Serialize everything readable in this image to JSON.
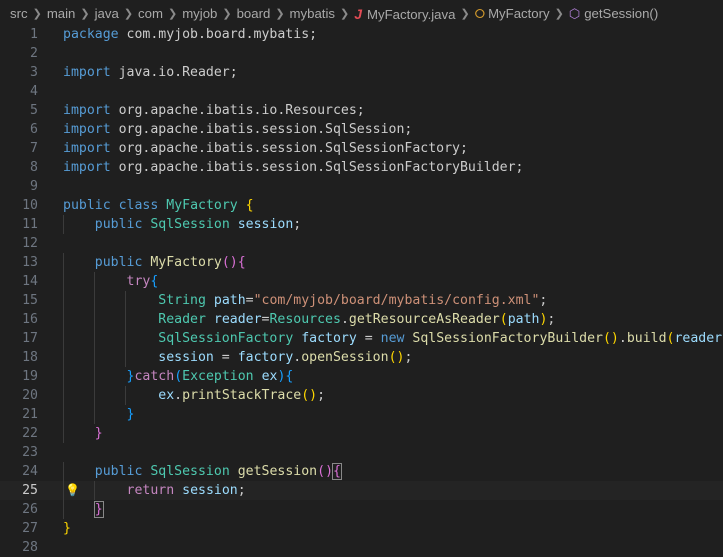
{
  "breadcrumb": {
    "items": [
      "src",
      "main",
      "java",
      "com",
      "myjob",
      "board",
      "mybatis"
    ],
    "file": "MyFactory.java",
    "class": "MyFactory",
    "method": "getSession()"
  },
  "editor": {
    "current_line": 25,
    "lines": [
      {
        "n": "1",
        "t": [
          [
            "kw",
            "package"
          ],
          [
            "pl",
            " com.myjob.board.mybatis;"
          ]
        ]
      },
      {
        "n": "2",
        "t": []
      },
      {
        "n": "3",
        "t": [
          [
            "kw",
            "import"
          ],
          [
            "pl",
            " java.io.Reader;"
          ]
        ]
      },
      {
        "n": "4",
        "t": []
      },
      {
        "n": "5",
        "t": [
          [
            "kw",
            "import"
          ],
          [
            "pl",
            " org.apache.ibatis.io.Resources;"
          ]
        ]
      },
      {
        "n": "6",
        "t": [
          [
            "kw",
            "import"
          ],
          [
            "pl",
            " org.apache.ibatis.session.SqlSession;"
          ]
        ]
      },
      {
        "n": "7",
        "t": [
          [
            "kw",
            "import"
          ],
          [
            "pl",
            " org.apache.ibatis.session.SqlSessionFactory;"
          ]
        ]
      },
      {
        "n": "8",
        "t": [
          [
            "kw",
            "import"
          ],
          [
            "pl",
            " org.apache.ibatis.session.SqlSessionFactoryBuilder;"
          ]
        ]
      },
      {
        "n": "9",
        "t": []
      },
      {
        "n": "10",
        "t": [
          [
            "kw",
            "public"
          ],
          [
            "pl",
            " "
          ],
          [
            "kw",
            "class"
          ],
          [
            "pl",
            " "
          ],
          [
            "ty",
            "MyFactory"
          ],
          [
            "pl",
            " "
          ],
          [
            "b1",
            "{"
          ]
        ]
      },
      {
        "n": "11",
        "t": [
          [
            "pl",
            "    "
          ],
          [
            "kw",
            "public"
          ],
          [
            "pl",
            " "
          ],
          [
            "ty",
            "SqlSession"
          ],
          [
            "pl",
            " "
          ],
          [
            "va",
            "session"
          ],
          [
            "pl",
            ";"
          ]
        ]
      },
      {
        "n": "12",
        "t": []
      },
      {
        "n": "13",
        "t": [
          [
            "pl",
            "    "
          ],
          [
            "kw",
            "public"
          ],
          [
            "pl",
            " "
          ],
          [
            "fn",
            "MyFactory"
          ],
          [
            "b2",
            "()"
          ],
          [
            "b2",
            "{"
          ]
        ]
      },
      {
        "n": "14",
        "t": [
          [
            "pl",
            "        "
          ],
          [
            "kc",
            "try"
          ],
          [
            "b3",
            "{"
          ]
        ]
      },
      {
        "n": "15",
        "t": [
          [
            "pl",
            "            "
          ],
          [
            "ty",
            "String"
          ],
          [
            "pl",
            " "
          ],
          [
            "va",
            "path"
          ],
          [
            "pl",
            "="
          ],
          [
            "st",
            "\"com/myjob/board/mybatis/config.xml\""
          ],
          [
            "pl",
            ";"
          ]
        ]
      },
      {
        "n": "16",
        "t": [
          [
            "pl",
            "            "
          ],
          [
            "ty",
            "Reader"
          ],
          [
            "pl",
            " "
          ],
          [
            "va",
            "reader"
          ],
          [
            "pl",
            "="
          ],
          [
            "ty",
            "Resources"
          ],
          [
            "pl",
            "."
          ],
          [
            "fn",
            "getResourceAsReader"
          ],
          [
            "b1",
            "("
          ],
          [
            "va",
            "path"
          ],
          [
            "b1",
            ")"
          ],
          [
            "pl",
            ";"
          ]
        ]
      },
      {
        "n": "17",
        "t": [
          [
            "pl",
            "            "
          ],
          [
            "ty",
            "SqlSessionFactory"
          ],
          [
            "pl",
            " "
          ],
          [
            "va",
            "factory"
          ],
          [
            "pl",
            " = "
          ],
          [
            "kw",
            "new"
          ],
          [
            "pl",
            " "
          ],
          [
            "fn",
            "SqlSessionFactoryBuilder"
          ],
          [
            "b1",
            "()"
          ],
          [
            "pl",
            "."
          ],
          [
            "fn",
            "build"
          ],
          [
            "b1",
            "("
          ],
          [
            "va",
            "reader"
          ],
          [
            "b1",
            ")"
          ],
          [
            "pl",
            ";"
          ]
        ]
      },
      {
        "n": "18",
        "t": [
          [
            "pl",
            "            "
          ],
          [
            "va",
            "session"
          ],
          [
            "pl",
            " = "
          ],
          [
            "va",
            "factory"
          ],
          [
            "pl",
            "."
          ],
          [
            "fn",
            "openSession"
          ],
          [
            "b1",
            "()"
          ],
          [
            "pl",
            ";"
          ]
        ]
      },
      {
        "n": "19",
        "t": [
          [
            "pl",
            "        "
          ],
          [
            "b3",
            "}"
          ],
          [
            "kc",
            "catch"
          ],
          [
            "b3",
            "("
          ],
          [
            "ty",
            "Exception"
          ],
          [
            "pl",
            " "
          ],
          [
            "va",
            "ex"
          ],
          [
            "b3",
            ")"
          ],
          [
            "b3",
            "{"
          ]
        ]
      },
      {
        "n": "20",
        "t": [
          [
            "pl",
            "            "
          ],
          [
            "va",
            "ex"
          ],
          [
            "pl",
            "."
          ],
          [
            "fn",
            "printStackTrace"
          ],
          [
            "b1",
            "()"
          ],
          [
            "pl",
            ";"
          ]
        ]
      },
      {
        "n": "21",
        "t": [
          [
            "pl",
            "        "
          ],
          [
            "b3",
            "}"
          ]
        ]
      },
      {
        "n": "22",
        "t": [
          [
            "pl",
            "    "
          ],
          [
            "b2",
            "}"
          ]
        ]
      },
      {
        "n": "23",
        "t": []
      },
      {
        "n": "24",
        "t": [
          [
            "pl",
            "    "
          ],
          [
            "kw",
            "public"
          ],
          [
            "pl",
            " "
          ],
          [
            "ty",
            "SqlSession"
          ],
          [
            "pl",
            " "
          ],
          [
            "fn",
            "getSession"
          ],
          [
            "b2",
            "()"
          ],
          [
            "b2m",
            "{"
          ]
        ]
      },
      {
        "n": "25",
        "t": [
          [
            "pl",
            "        "
          ],
          [
            "kc",
            "return"
          ],
          [
            "pl",
            " "
          ],
          [
            "va",
            "session"
          ],
          [
            "pl",
            ";"
          ]
        ]
      },
      {
        "n": "26",
        "t": [
          [
            "pl",
            "    "
          ],
          [
            "b2m",
            "}"
          ]
        ]
      },
      {
        "n": "27",
        "t": [
          [
            "b1",
            "}"
          ]
        ]
      },
      {
        "n": "28",
        "t": []
      }
    ]
  }
}
